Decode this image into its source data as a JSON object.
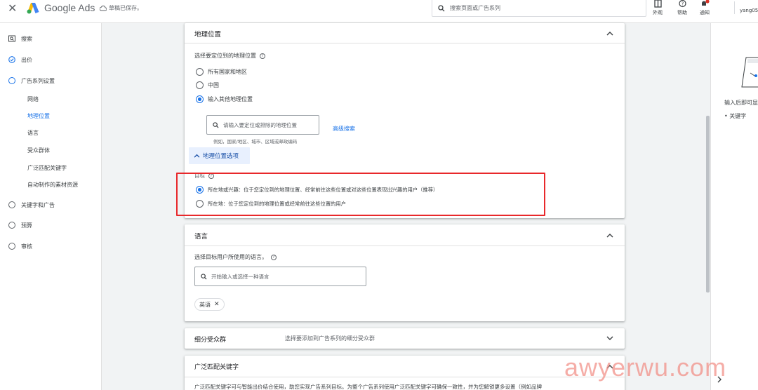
{
  "topbar": {
    "close": "✕",
    "brand": "Google Ads",
    "saved_status": "草稿已保存。",
    "search_placeholder": "搜索页面或广告系列",
    "icons": [
      {
        "name": "appearance",
        "label": "外观"
      },
      {
        "name": "help",
        "label": "帮助"
      },
      {
        "name": "notifications",
        "label": "通知"
      }
    ],
    "account": "yang05"
  },
  "sidenav": {
    "items": [
      {
        "label": "搜索",
        "icon": "search-box-icon"
      },
      {
        "label": "出价",
        "icon": "check-circle-icon"
      },
      {
        "label": "广告系列设置",
        "icon": "circle-icon"
      },
      {
        "label": "关键字和广告",
        "icon": "circle-icon"
      },
      {
        "label": "预算",
        "icon": "circle-icon"
      },
      {
        "label": "审核",
        "icon": "circle-icon"
      }
    ],
    "subitems": [
      "网络",
      "地理位置",
      "语言",
      "受众群体",
      "广泛匹配关键字",
      "自动制作的素材资源"
    ]
  },
  "geo": {
    "title": "地理位置",
    "prompt": "选择要定位到的地理位置",
    "options": [
      "所有国家和地区",
      "中国",
      "输入其他地理位置"
    ],
    "selected": "输入其他地理位置",
    "search_placeholder": "请输入要定位或排除的地理位置",
    "advanced_search": "高级搜索",
    "example": "例如，国家/地区、城市、区域或邮政编码",
    "options_button": "地理位置选项",
    "target_label": "目标",
    "target_options": [
      "所在地或兴趣：位于您定位到的地理位置、经常前往这些位置或对这些位置表现出兴趣的用户（推荐）",
      "所在地：位于您定位到的地理位置或经常前往这些位置的用户"
    ],
    "target_selected": 0
  },
  "language": {
    "title": "语言",
    "prompt": "选择目标用户所使用的语言。",
    "search_placeholder": "开始输入或选择一种语言",
    "chips": [
      "英语"
    ]
  },
  "audience": {
    "title": "细分受众群",
    "summary": "选择要添加到广告系列的细分受众群"
  },
  "broad": {
    "title": "广泛匹配关键字",
    "desc": "广泛匹配关键字可与智能出价结合使用，助您实现广告系列目标。为整个广告系列使用广泛匹配关键字可确保一致性，并为您解锁更多设置（例如品牌"
  },
  "rpanel": {
    "text": "输入后即可显",
    "bullet": "关键字"
  },
  "watermark": "awyerwu.com",
  "colors": {
    "accent": "#1a73e8",
    "highlight_box": "#e8282b"
  }
}
